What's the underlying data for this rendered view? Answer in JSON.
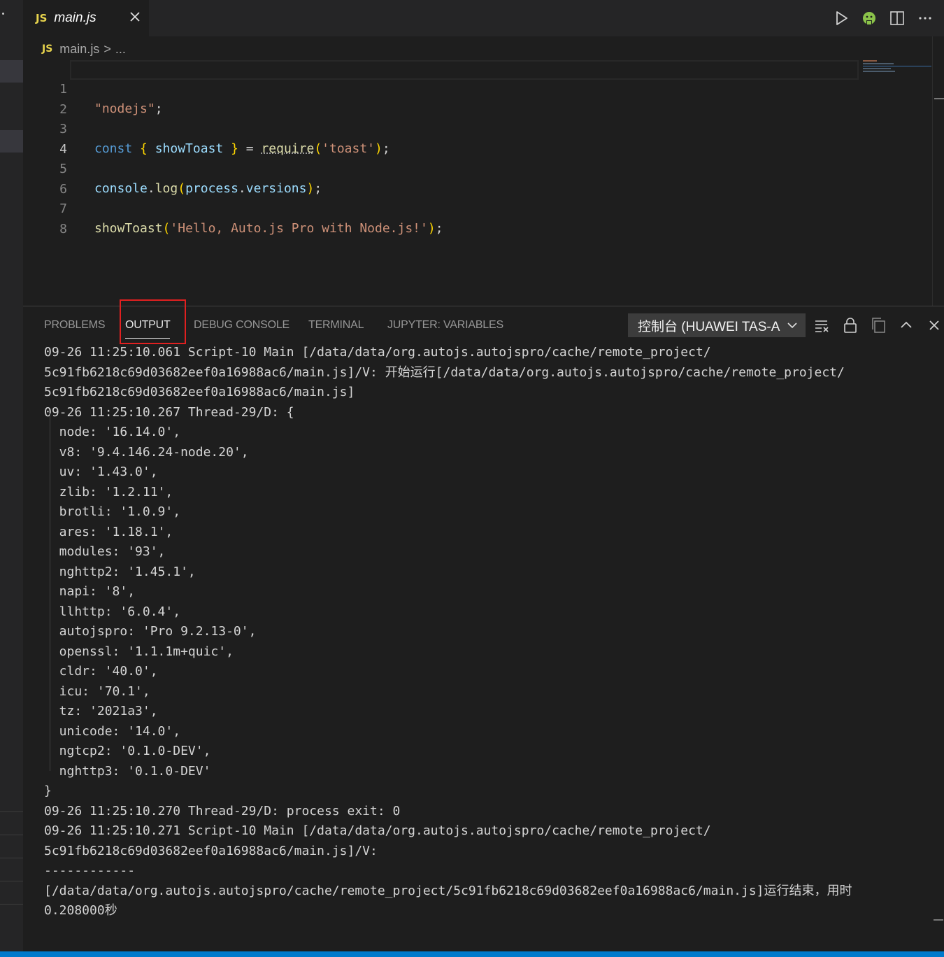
{
  "editor_tab": {
    "badge": "JS",
    "filename": "main.js"
  },
  "breadcrumb": {
    "badge": "JS",
    "file": "main.js",
    "separator": ">",
    "rest": "..."
  },
  "code_lines": [
    {
      "num": "1"
    },
    {
      "num": "2"
    },
    {
      "num": "3"
    },
    {
      "num": "4"
    },
    {
      "num": "5"
    },
    {
      "num": "6"
    },
    {
      "num": "7"
    },
    {
      "num": "8"
    }
  ],
  "code": {
    "l1_str": "\"nodejs\"",
    "l1_semi": ";",
    "l3_const": "const",
    "l3_ob": "{",
    "l3_name": " showToast ",
    "l3_cb": "}",
    "l3_eq": " = ",
    "l3_req": "require",
    "l3_op": "(",
    "l3_str": "'toast'",
    "l3_cp": ")",
    "l3_semi": ";",
    "l5_console": "console",
    "l5_dot1": ".",
    "l5_log": "log",
    "l5_op": "(",
    "l5_process": "process",
    "l5_dot2": ".",
    "l5_versions": "versions",
    "l5_cp": ")",
    "l5_semi": ";",
    "l7_fn": "showToast",
    "l7_op": "(",
    "l7_str": "'Hello, Auto.js Pro with Node.js!'",
    "l7_cp": ")",
    "l7_semi": ";"
  },
  "panel": {
    "tabs": [
      {
        "label": "PROBLEMS"
      },
      {
        "label": "OUTPUT"
      },
      {
        "label": "DEBUG CONSOLE"
      },
      {
        "label": "TERMINAL"
      },
      {
        "label": "JUPYTER: VARIABLES"
      }
    ],
    "active_tab": "OUTPUT",
    "channel": "控制台 (HUAWEI TAS-A"
  },
  "output_lines": [
    "09-26 11:25:10.061 Script-10 Main [/data/data/org.autojs.autojspro/cache/remote_project/",
    "5c91fb6218c69d03682eef0a16988ac6/main.js]/V: 开始运行[/data/data/org.autojs.autojspro/cache/remote_project/",
    "5c91fb6218c69d03682eef0a16988ac6/main.js]",
    "09-26 11:25:10.267 Thread-29/D: {",
    "  node: '16.14.0',",
    "  v8: '9.4.146.24-node.20',",
    "  uv: '1.43.0',",
    "  zlib: '1.2.11',",
    "  brotli: '1.0.9',",
    "  ares: '1.18.1',",
    "  modules: '93',",
    "  nghttp2: '1.45.1',",
    "  napi: '8',",
    "  llhttp: '6.0.4',",
    "  autojspro: 'Pro 9.2.13-0',",
    "  openssl: '1.1.1m+quic',",
    "  cldr: '40.0',",
    "  icu: '70.1',",
    "  tz: '2021a3',",
    "  unicode: '14.0',",
    "  ngtcp2: '0.1.0-DEV',",
    "  nghttp3: '0.1.0-DEV'",
    "}",
    "09-26 11:25:10.270 Thread-29/D: process exit: 0",
    "09-26 11:25:10.271 Script-10 Main [/data/data/org.autojs.autojspro/cache/remote_project/",
    "5c91fb6218c69d03682eef0a16988ac6/main.js]/V: ",
    "------------",
    "[/data/data/org.autojs.autojspro/cache/remote_project/5c91fb6218c69d03682eef0a16988ac6/main.js]运行结束，用时",
    "0.208000秒"
  ],
  "colors": {
    "accent": "#007acc",
    "highlight_box": "#e02020",
    "js_badge": "#e8d44d",
    "android_icon": "#8bc34a"
  },
  "icons": [
    "close-icon",
    "run-icon",
    "android-debug-icon",
    "split-editor-icon",
    "more-icon",
    "clear-output-icon",
    "lock-icon",
    "copy-icon",
    "chevron-up-icon",
    "panel-close-icon",
    "chevron-down-icon"
  ]
}
